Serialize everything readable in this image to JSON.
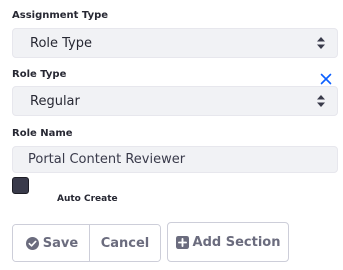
{
  "assignment_type": {
    "label": "Assignment Type",
    "value": "Role Type"
  },
  "role_type": {
    "label": "Role Type",
    "value": "Regular"
  },
  "role_name": {
    "label": "Role Name",
    "value": "Portal Content Reviewer"
  },
  "auto_create": {
    "label": "Auto Create",
    "checked": false
  },
  "actions": {
    "save_label": "Save",
    "cancel_label": "Cancel",
    "add_section_label": "Add Section"
  },
  "colors": {
    "accent": "#0b5fff",
    "button_text": "#6b6c7e",
    "field_bg": "#f1f2f5"
  }
}
